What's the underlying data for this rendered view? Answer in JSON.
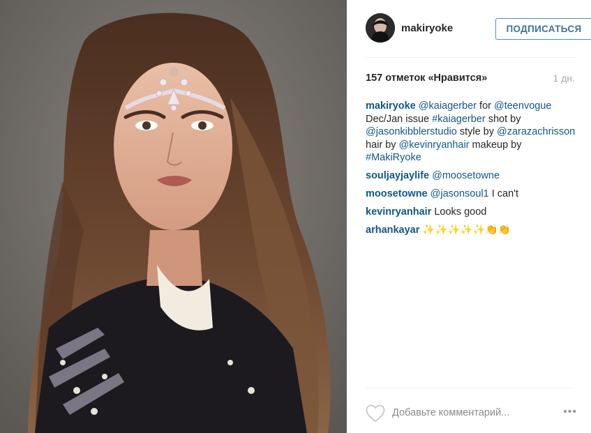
{
  "post": {
    "image_alt": "Portrait of a young woman with long wavy brown hair, pearl and rhinestone face jewels, and a sequined black jacket"
  },
  "header": {
    "username": "makiryoke",
    "follow_label": "ПОДПИСАТЬСЯ"
  },
  "stats": {
    "likes": "157 отметок «Нравится»",
    "time": "1 дн."
  },
  "comments": [
    {
      "user": "makiryoke",
      "parts": [
        {
          "text": "@kaiagerber",
          "link": true
        },
        {
          "text": " for ",
          "link": false
        },
        {
          "text": "@teenvogue",
          "link": true
        },
        {
          "text": " Dec/Jan issue ",
          "link": false
        },
        {
          "text": "#kaiagerber",
          "link": true
        },
        {
          "text": " shot by ",
          "link": false
        },
        {
          "text": "@jasonkibblerstudio",
          "link": true
        },
        {
          "text": " style by ",
          "link": false
        },
        {
          "text": "@zarazachrisson",
          "link": true
        },
        {
          "text": " hair by ",
          "link": false
        },
        {
          "text": "@kevinryanhair",
          "link": true
        },
        {
          "text": " makeup by ",
          "link": false
        },
        {
          "text": "#MakiRyoke",
          "link": true
        }
      ]
    },
    {
      "user": "souljayjaylife",
      "parts": [
        {
          "text": "@moosetowne",
          "link": true
        }
      ]
    },
    {
      "user": "moosetowne",
      "parts": [
        {
          "text": "@jasonsoul1",
          "link": true
        },
        {
          "text": " I can't",
          "link": false
        }
      ]
    },
    {
      "user": "kevinryanhair",
      "parts": [
        {
          "text": "Looks good",
          "link": false
        }
      ]
    },
    {
      "user": "arhankayar",
      "parts": [
        {
          "text": "✨✨✨✨✨👏👏",
          "link": false
        }
      ]
    }
  ],
  "footer": {
    "comment_placeholder": "Добавьте комментарий...",
    "more_label": "•••"
  },
  "colors": {
    "link": "#125688",
    "follow_border": "#4a8cc7",
    "follow_text": "#3f729b",
    "muted": "#a5a7aa"
  }
}
